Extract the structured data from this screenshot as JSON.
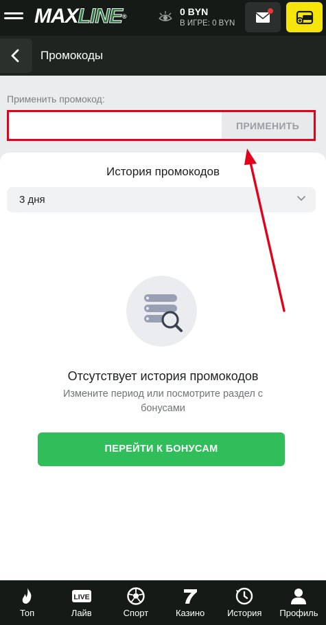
{
  "header": {
    "logo_part1": "MAX",
    "logo_part2": "LINE",
    "logo_reg": "®",
    "balance": "0 BYN",
    "in_game": "В ИГРЕ: 0 BYN",
    "icons": [
      "menu-icon",
      "eye-icon",
      "mail-icon",
      "wallet-icon"
    ],
    "notification_color": "#e53935"
  },
  "subheader": {
    "title": "Промокоды",
    "back_icon": "chevron-left-icon"
  },
  "promo": {
    "label": "Применить промокод:",
    "input_value": "",
    "apply_label": "ПРИМЕНИТЬ",
    "highlight_color": "#e2001a"
  },
  "history": {
    "title": "История промокодов",
    "period_selected": "3 дня",
    "empty_title": "Отсутствует история промокодов",
    "empty_subtitle": "Измените период или посмотрите раздел с бонусами",
    "cta_label": "ПЕРЕЙТИ К БОНУСАМ",
    "cta_color": "#2fbe5a"
  },
  "bottom_nav": {
    "items": [
      {
        "label": "Топ",
        "icon": "flame-icon"
      },
      {
        "label": "Лайв",
        "icon": "live-icon"
      },
      {
        "label": "Спорт",
        "icon": "soccer-ball-icon"
      },
      {
        "label": "Казино",
        "icon": "seven-icon"
      },
      {
        "label": "История",
        "icon": "history-clock-icon"
      },
      {
        "label": "Профиль",
        "icon": "user-icon"
      }
    ],
    "live_badge": "LIVE"
  }
}
